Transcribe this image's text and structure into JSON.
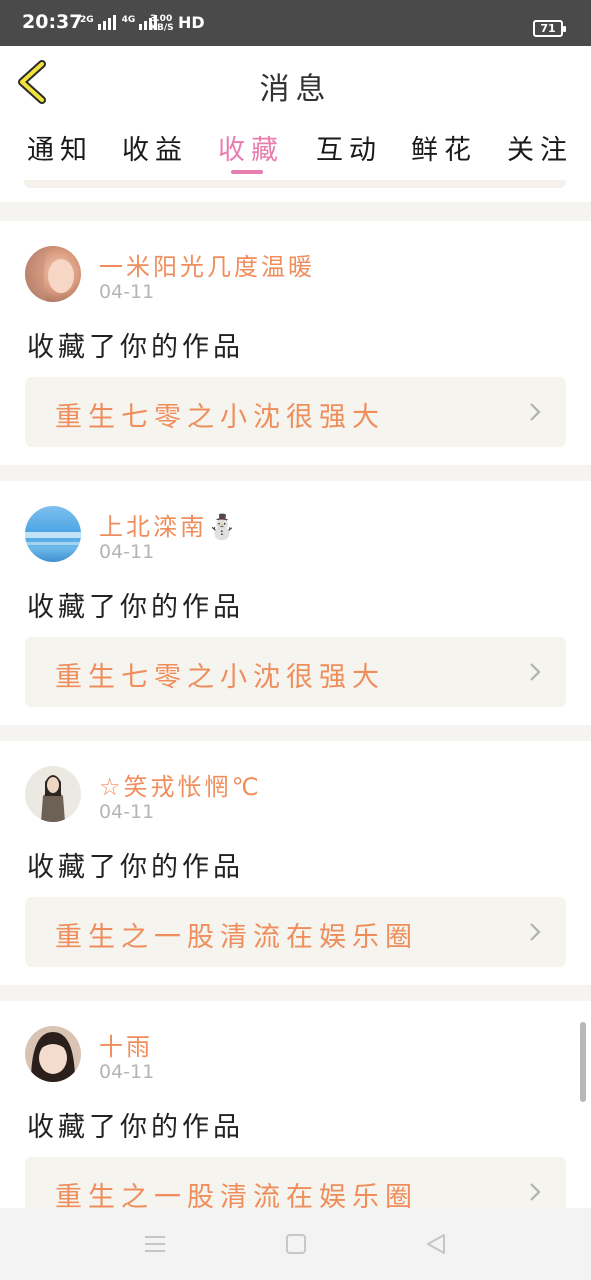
{
  "status_bar": {
    "time": "20:37",
    "sim1": "2G",
    "sim2": "4G",
    "speed_value": "3.00",
    "speed_unit": "KB/S",
    "hd": "HD",
    "battery": "71"
  },
  "header": {
    "title": "消息"
  },
  "tabs": [
    {
      "label": "通知"
    },
    {
      "label": "收益"
    },
    {
      "label": "收藏"
    },
    {
      "label": "互动"
    },
    {
      "label": "鲜花"
    },
    {
      "label": "关注"
    }
  ],
  "active_tab": "收藏",
  "accent_color": "#e87db0",
  "name_color": "#ef8e5c",
  "items": [
    {
      "user": "一米阳光几度温暖",
      "date": "04-11",
      "action": "收藏了你的作品",
      "work": "重生七零之小沈很强大",
      "avatar_icon": "avatar-photo"
    },
    {
      "user": "上北滦南⛄",
      "date": "04-11",
      "action": "收藏了你的作品",
      "work": "重生七零之小沈很强大",
      "avatar_icon": "avatar-sky"
    },
    {
      "user": "☆笑戎怅惘℃",
      "date": "04-11",
      "action": "收藏了你的作品",
      "work": "重生之一股清流在娱乐圈",
      "avatar_icon": "avatar-person"
    },
    {
      "user": "十雨",
      "date": "04-11",
      "action": "收藏了你的作品",
      "work": "重生之一股清流在娱乐圈",
      "avatar_icon": "avatar-child"
    }
  ]
}
